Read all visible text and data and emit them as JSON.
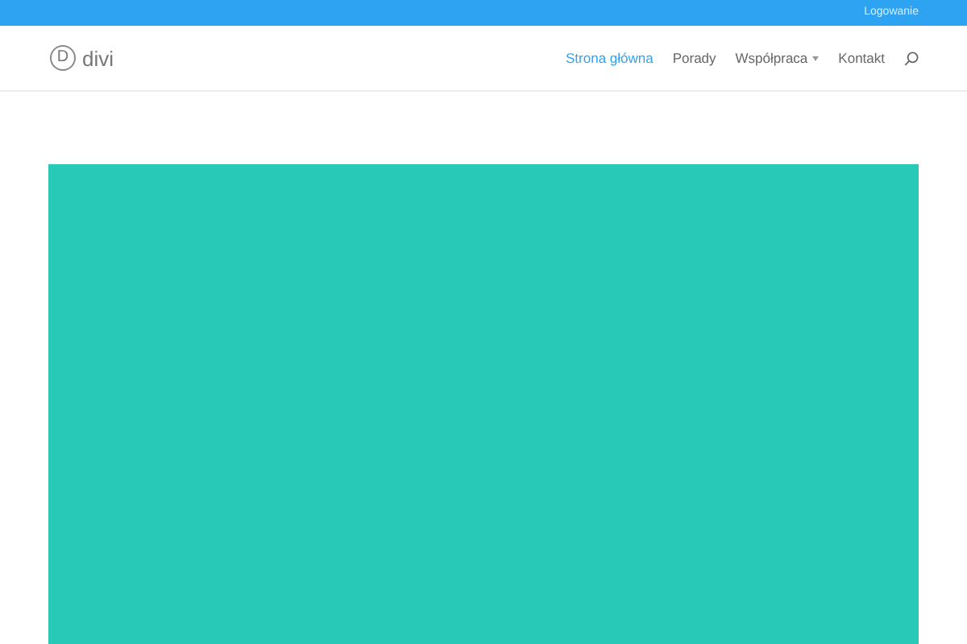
{
  "top_bar": {
    "links": [
      "Logowanie"
    ]
  },
  "header": {
    "logo": {
      "mark": "D",
      "text": "divi"
    },
    "menu": [
      {
        "label": "Strona główna",
        "selected": true,
        "dropdown": false
      },
      {
        "label": "Porady",
        "selected": false,
        "dropdown": false
      },
      {
        "label": "Współpraca",
        "selected": false,
        "dropdown": true
      },
      {
        "label": "Kontakt",
        "selected": false,
        "dropdown": false
      }
    ]
  }
}
